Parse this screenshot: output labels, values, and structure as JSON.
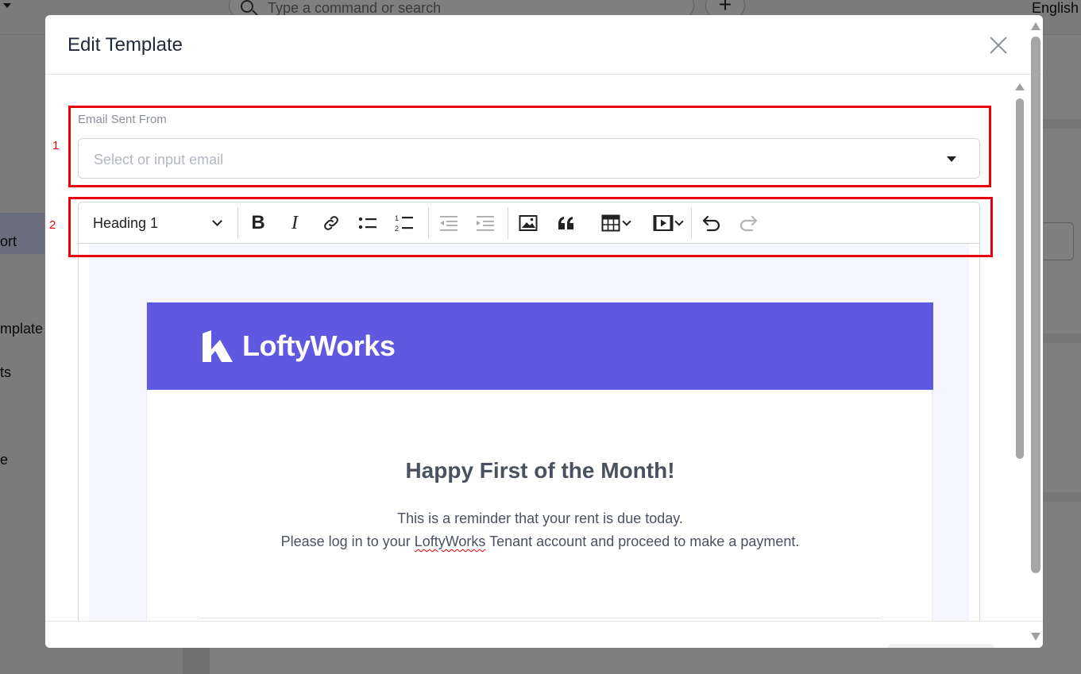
{
  "background": {
    "search_placeholder": "Type a command or search",
    "plus_label": "+",
    "language": "English",
    "sidebar_items": [
      "ort",
      "mplate",
      "ts",
      "e"
    ]
  },
  "modal": {
    "title": "Edit Template",
    "close_icon": "close-icon"
  },
  "annotations": [
    "1",
    "2"
  ],
  "email_from": {
    "label": "Email Sent From",
    "placeholder": "Select or input email",
    "value": ""
  },
  "toolbar": {
    "heading_value": "Heading 1",
    "buttons": [
      "bold",
      "italic",
      "link",
      "bulleted-list",
      "numbered-list",
      "outdent",
      "indent",
      "image",
      "blockquote",
      "table",
      "media",
      "undo",
      "redo"
    ],
    "bold_glyph": "B",
    "italic_glyph": "I"
  },
  "email_content": {
    "logo_text": "LoftyWorks",
    "heading": "Happy First of the Month!",
    "line1": "This is a reminder that your rent is due today.",
    "line2_before": "Please log in to your ",
    "line2_brand": "LoftyWorks",
    "line2_after": " Tenant account and proceed to make a payment."
  },
  "colors": {
    "banner": "#5f58e0",
    "annotation": "#e8000b",
    "editor_background": "#f5f5fd"
  }
}
